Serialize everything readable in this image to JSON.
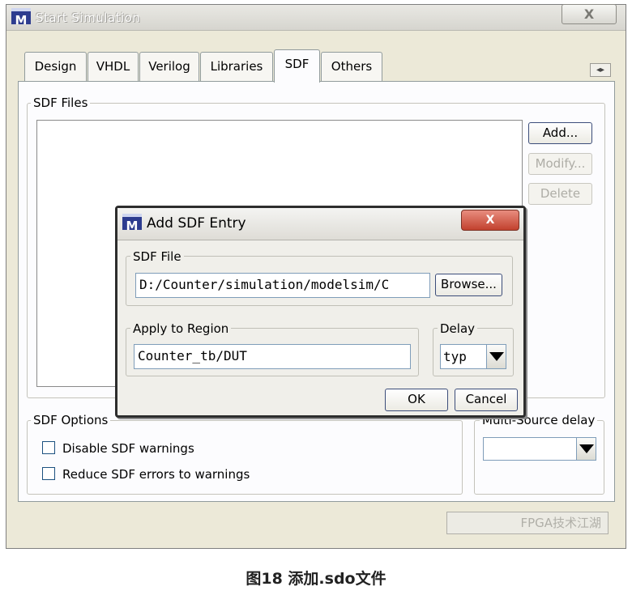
{
  "window": {
    "icon_letter": "M",
    "title": "Start Simulation",
    "close_glyph": "X"
  },
  "tabs": [
    {
      "label": "Design",
      "active": false
    },
    {
      "label": "VHDL",
      "active": false
    },
    {
      "label": "Verilog",
      "active": false
    },
    {
      "label": "Libraries",
      "active": false
    },
    {
      "label": "SDF",
      "active": true
    },
    {
      "label": "Others",
      "active": false
    }
  ],
  "tab_scroll": {
    "left": "◂",
    "right": "▸"
  },
  "sdf_files": {
    "legend": "SDF Files",
    "add_label": "Add...",
    "modify_label": "Modify...",
    "delete_label": "Delete"
  },
  "sdf_options": {
    "legend": "SDF Options",
    "disable_warnings": {
      "label": "Disable SDF warnings",
      "checked": false
    },
    "reduce_errors": {
      "label": "Reduce SDF errors to warnings",
      "checked": false
    }
  },
  "multi_source": {
    "legend": "Multi-Source delay",
    "value": ""
  },
  "watermark": "FPGA技术江湖",
  "dialog": {
    "icon_letter": "M",
    "title": "Add SDF Entry",
    "close_glyph": "X",
    "sdf_file": {
      "legend": "SDF File",
      "value": "D:/Counter/simulation/modelsim/C",
      "browse_label": "Browse..."
    },
    "region": {
      "legend": "Apply to Region",
      "value": "Counter_tb/DUT"
    },
    "delay": {
      "legend": "Delay",
      "value": "typ"
    },
    "ok_label": "OK",
    "cancel_label": "Cancel"
  },
  "caption": "图18 添加.sdo文件",
  "colors": {
    "dialog_close": "#c2412e",
    "app_icon": "#2d3c8f",
    "button_border": "#3c4d7a"
  }
}
